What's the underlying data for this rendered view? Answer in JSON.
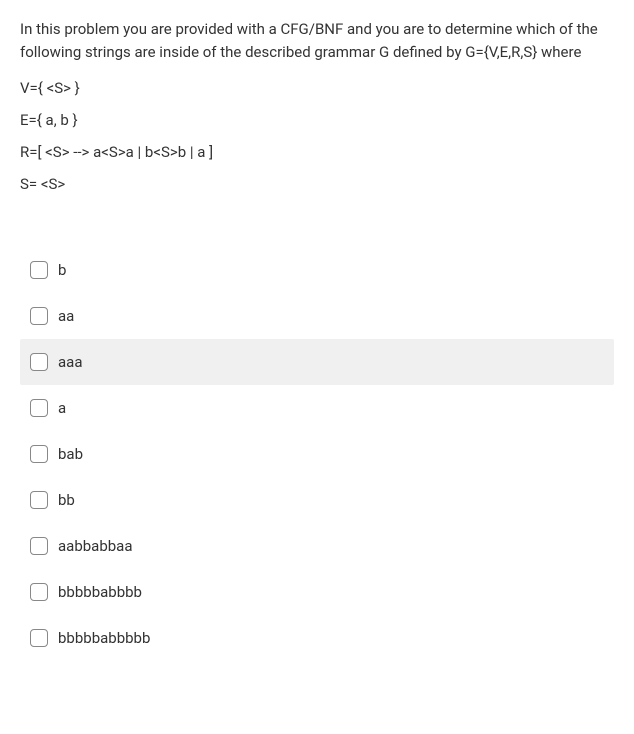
{
  "question": {
    "intro": "In this problem you are provided with a CFG/BNF and you are to determine which of the following strings are inside of the described grammar G defined by G={V,E,R,S} where",
    "v_line": "V={ <S> }",
    "e_line": "E={ a, b }",
    "r_line": "R=[ <S> --> a<S>a | b<S>b | a ]",
    "s_line": "S= <S>"
  },
  "options": [
    {
      "label": "b",
      "highlighted": false
    },
    {
      "label": "aa",
      "highlighted": false
    },
    {
      "label": "aaa",
      "highlighted": true
    },
    {
      "label": "a",
      "highlighted": false
    },
    {
      "label": "bab",
      "highlighted": false
    },
    {
      "label": "bb",
      "highlighted": false
    },
    {
      "label": "aabbabbaa",
      "highlighted": false
    },
    {
      "label": "bbbbbabbbb",
      "highlighted": false
    },
    {
      "label": "bbbbbabbbbb",
      "highlighted": false
    }
  ]
}
